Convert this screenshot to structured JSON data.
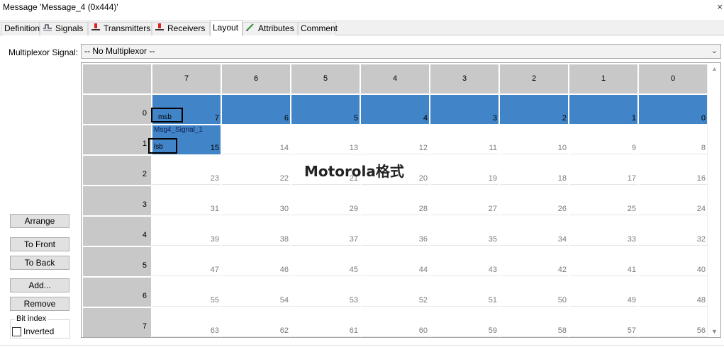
{
  "window": {
    "title": "Message 'Message_4 (0x444)'",
    "close_glyph": "×"
  },
  "tabs": [
    {
      "label": "Definition",
      "icon": ""
    },
    {
      "label": "Signals",
      "icon": "signals-icon"
    },
    {
      "label": "Transmitters",
      "icon": "transmitter-icon"
    },
    {
      "label": "Receivers",
      "icon": "receiver-icon"
    },
    {
      "label": "Layout",
      "icon": "",
      "active": true
    },
    {
      "label": "Attributes",
      "icon": "attributes-icon"
    },
    {
      "label": "Comment",
      "icon": ""
    }
  ],
  "multiplexor": {
    "label": "Multiplexor Signal:",
    "value": "-- No Multiplexor --"
  },
  "grid": {
    "column_headers": [
      "7",
      "6",
      "5",
      "4",
      "3",
      "2",
      "1",
      "0"
    ],
    "row_headers": [
      "0",
      "1",
      "2",
      "3",
      "4",
      "5",
      "6",
      "7"
    ],
    "cells": [
      [
        "7",
        "6",
        "5",
        "4",
        "3",
        "2",
        "1",
        "0"
      ],
      [
        "15",
        "14",
        "13",
        "12",
        "11",
        "10",
        "9",
        "8"
      ],
      [
        "23",
        "22",
        "21",
        "20",
        "19",
        "18",
        "17",
        "16"
      ],
      [
        "31",
        "30",
        "29",
        "28",
        "27",
        "26",
        "25",
        "24"
      ],
      [
        "39",
        "38",
        "37",
        "36",
        "35",
        "34",
        "33",
        "32"
      ],
      [
        "47",
        "46",
        "45",
        "44",
        "43",
        "42",
        "41",
        "40"
      ],
      [
        "55",
        "54",
        "53",
        "52",
        "51",
        "50",
        "49",
        "48"
      ],
      [
        "63",
        "62",
        "61",
        "60",
        "59",
        "58",
        "57",
        "56"
      ]
    ],
    "signal_name": "Msg4_Signal_1",
    "msb_label": "msb",
    "lsb_label": "lsb",
    "overlay_text": "Motorola格式",
    "highlight_color": "#4184c8"
  },
  "buttons": {
    "arrange": "Arrange",
    "to_front": "To Front",
    "to_back": "To Back",
    "add": "Add...",
    "remove": "Remove"
  },
  "bit_index": {
    "legend": "Bit index",
    "inverted_label": "Inverted",
    "inverted_checked": false
  }
}
